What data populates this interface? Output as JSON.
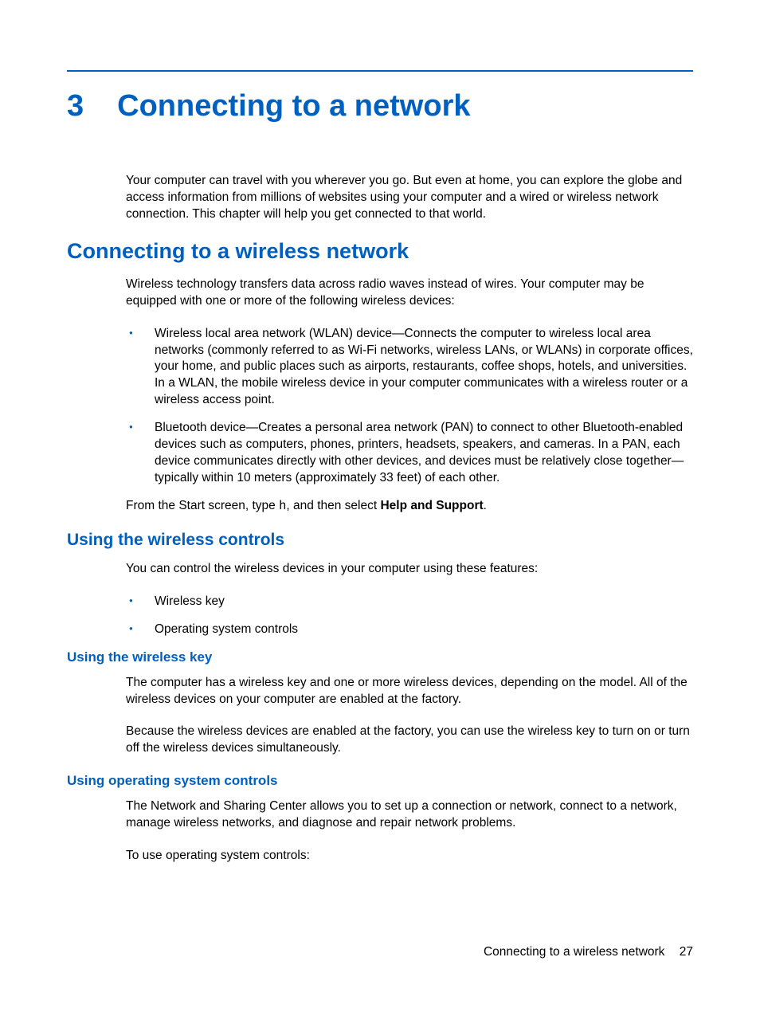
{
  "chapter": {
    "number": "3",
    "title": "Connecting to a network"
  },
  "intro": "Your computer can travel with you wherever you go. But even at home, you can explore the globe and access information from millions of websites using your computer and a wired or wireless network connection. This chapter will help you get connected to that world.",
  "section1": {
    "title": "Connecting to a wireless network",
    "para1": "Wireless technology transfers data across radio waves instead of wires. Your computer may be equipped with one or more of the following wireless devices:",
    "bullet1": "Wireless local area network (WLAN) device—Connects the computer to wireless local area networks (commonly referred to as Wi-Fi networks, wireless LANs, or WLANs) in corporate offices, your home, and public places such as airports, restaurants, coffee shops, hotels, and universities. In a WLAN, the mobile wireless device in your computer communicates with a wireless router or a wireless access point.",
    "bullet2": "Bluetooth device—Creates a personal area network (PAN) to connect to other Bluetooth-enabled devices such as computers, phones, printers, headsets, speakers, and cameras. In a PAN, each device communicates directly with other devices, and devices must be relatively close together—typically within 10 meters (approximately 33 feet) of each other.",
    "para2_pre": "From the Start screen, type ",
    "para2_code": "h",
    "para2_mid": ", and then select ",
    "para2_bold": "Help and Support",
    "para2_end": "."
  },
  "subsection1": {
    "title": "Using the wireless controls",
    "para1": "You can control the wireless devices in your computer using these features:",
    "bullet1": "Wireless key",
    "bullet2": "Operating system controls"
  },
  "subsub1": {
    "title": "Using the wireless key",
    "para1": "The computer has a wireless key and one or more wireless devices, depending on the model. All of the wireless devices on your computer are enabled at the factory.",
    "para2": "Because the wireless devices are enabled at the factory, you can use the wireless key to turn on or turn off the wireless devices simultaneously."
  },
  "subsub2": {
    "title": "Using operating system controls",
    "para1": "The Network and Sharing Center allows you to set up a connection or network, connect to a network, manage wireless networks, and diagnose and repair network problems.",
    "para2": "To use operating system controls:"
  },
  "footer": {
    "text": "Connecting to a wireless network",
    "page": "27"
  }
}
